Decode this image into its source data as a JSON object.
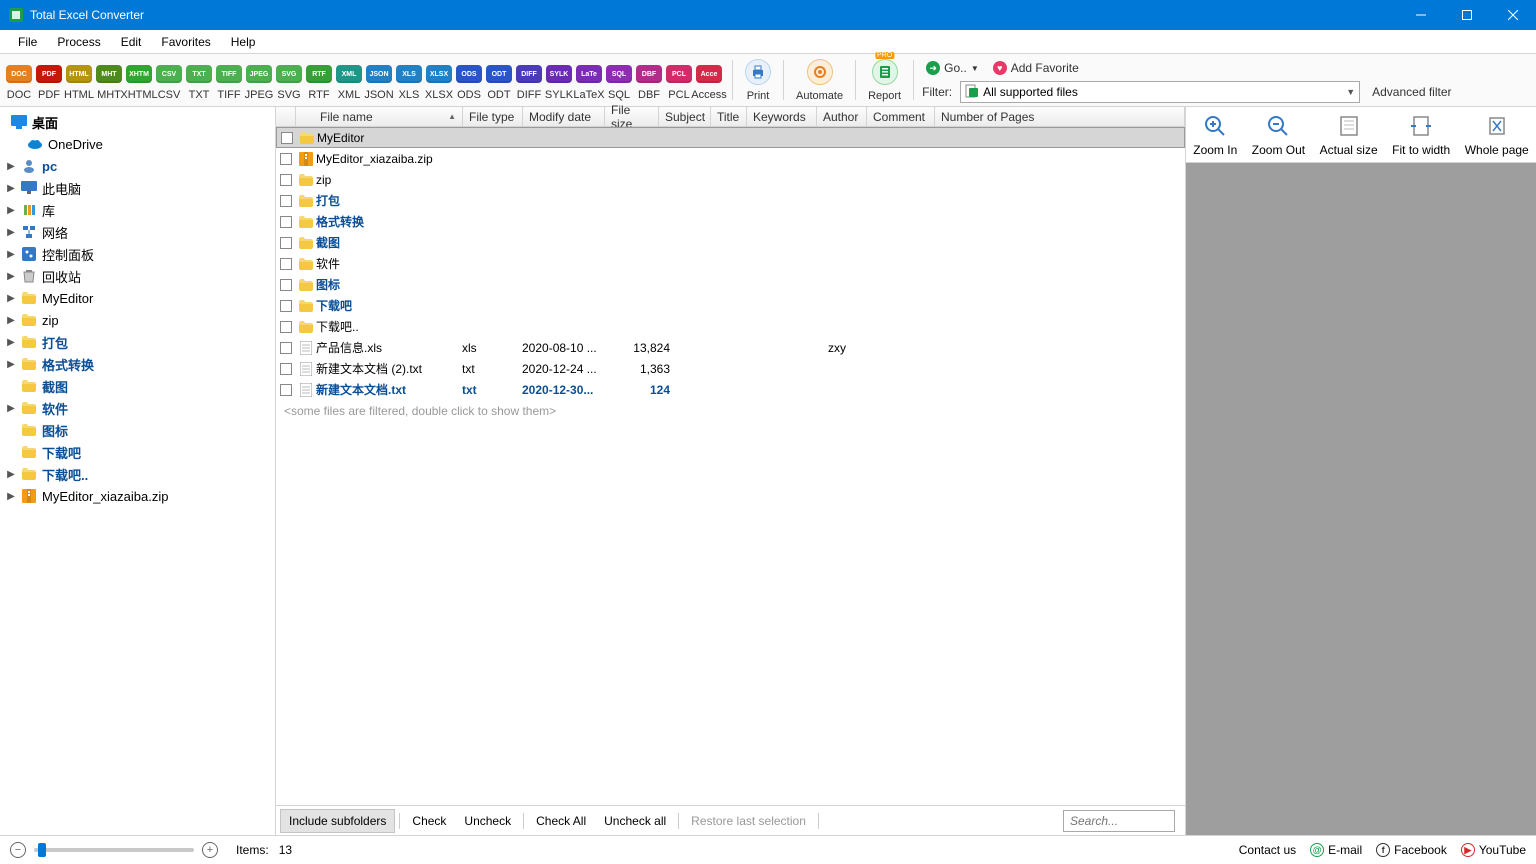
{
  "app": {
    "title": "Total Excel Converter"
  },
  "menu": [
    "File",
    "Process",
    "Edit",
    "Favorites",
    "Help"
  ],
  "formats": [
    {
      "label": "DOC",
      "color": "#e67e22"
    },
    {
      "label": "PDF",
      "color": "#c61808"
    },
    {
      "label": "HTML",
      "color": "#b59410"
    },
    {
      "label": "MHT",
      "color": "#4e8b1c"
    },
    {
      "label": "XHTML",
      "color": "#2fa62f"
    },
    {
      "label": "CSV",
      "color": "#4caf50"
    },
    {
      "label": "TXT",
      "color": "#4caf50"
    },
    {
      "label": "TIFF",
      "color": "#4caf50"
    },
    {
      "label": "JPEG",
      "color": "#4caf50"
    },
    {
      "label": "SVG",
      "color": "#4caf50"
    },
    {
      "label": "RTF",
      "color": "#36a036"
    },
    {
      "label": "XML",
      "color": "#1f9688"
    },
    {
      "label": "JSON",
      "color": "#2280c4"
    },
    {
      "label": "XLS",
      "color": "#2280c4"
    },
    {
      "label": "XLSX",
      "color": "#2280c4"
    },
    {
      "label": "ODS",
      "color": "#2a55c6"
    },
    {
      "label": "ODT",
      "color": "#2a55c6"
    },
    {
      "label": "DIFF",
      "color": "#4b3bb8"
    },
    {
      "label": "SYLK",
      "color": "#6a2cb4"
    },
    {
      "label": "LaTeX",
      "color": "#7a2cb4"
    },
    {
      "label": "SQL",
      "color": "#8e2cb4"
    },
    {
      "label": "DBF",
      "color": "#b42c8a"
    },
    {
      "label": "PCL",
      "color": "#d12c6a"
    },
    {
      "label": "Access",
      "color": "#d12c4a"
    }
  ],
  "tools": {
    "print": "Print",
    "automate": "Automate",
    "report": "Report",
    "go": "Go.. ",
    "addfav": "Add Favorite",
    "filter_label": "Filter:",
    "filter_value": "All supported files",
    "advfilter": "Advanced filter"
  },
  "tree": {
    "root": "桌面",
    "items": [
      {
        "label": "OneDrive",
        "icon": "cloud",
        "expandable": false,
        "child": true
      },
      {
        "label": "pc",
        "icon": "user",
        "expandable": true,
        "blue": true
      },
      {
        "label": "此电脑",
        "icon": "monitor",
        "expandable": true
      },
      {
        "label": "库",
        "icon": "library",
        "expandable": true
      },
      {
        "label": "网络",
        "icon": "network",
        "expandable": true
      },
      {
        "label": "控制面板",
        "icon": "control",
        "expandable": true
      },
      {
        "label": "回收站",
        "icon": "trash",
        "expandable": true
      },
      {
        "label": "MyEditor",
        "icon": "folder",
        "expandable": true
      },
      {
        "label": "zip",
        "icon": "folder",
        "expandable": true
      },
      {
        "label": "打包",
        "icon": "folder",
        "expandable": true,
        "blue": true
      },
      {
        "label": "格式转换",
        "icon": "folder",
        "expandable": true,
        "blue": true
      },
      {
        "label": "截图",
        "icon": "folder",
        "expandable": false,
        "blue": true
      },
      {
        "label": "软件",
        "icon": "folder",
        "expandable": true,
        "blue": true
      },
      {
        "label": "图标",
        "icon": "folder",
        "expandable": false,
        "blue": true
      },
      {
        "label": "下载吧",
        "icon": "folder",
        "expandable": false,
        "blue": true
      },
      {
        "label": "下载吧..",
        "icon": "folder",
        "expandable": true,
        "blue": true
      },
      {
        "label": "MyEditor_xiazaiba.zip",
        "icon": "zip",
        "expandable": true
      }
    ]
  },
  "file_header": [
    "File name",
    "File type",
    "Modify date",
    "File size",
    "Subject",
    "Title",
    "Keywords",
    "Author",
    "Comment",
    "Number of Pages"
  ],
  "files": [
    {
      "name": "MyEditor",
      "type": "",
      "date": "",
      "size": "",
      "author": "",
      "icon": "folder",
      "selected": true
    },
    {
      "name": "MyEditor_xiazaiba.zip",
      "type": "",
      "date": "",
      "size": "",
      "author": "",
      "icon": "zip"
    },
    {
      "name": "zip",
      "type": "",
      "date": "",
      "size": "",
      "author": "",
      "icon": "folder"
    },
    {
      "name": "打包",
      "type": "",
      "date": "",
      "size": "",
      "author": "",
      "icon": "folder",
      "blue": true
    },
    {
      "name": "格式转换",
      "type": "",
      "date": "",
      "size": "",
      "author": "",
      "icon": "folder",
      "blue": true
    },
    {
      "name": "截图",
      "type": "",
      "date": "",
      "size": "",
      "author": "",
      "icon": "folder",
      "blue": true
    },
    {
      "name": "软件",
      "type": "",
      "date": "",
      "size": "",
      "author": "",
      "icon": "folder"
    },
    {
      "name": "图标",
      "type": "",
      "date": "",
      "size": "",
      "author": "",
      "icon": "folder",
      "blue": true
    },
    {
      "name": "下载吧",
      "type": "",
      "date": "",
      "size": "",
      "author": "",
      "icon": "folder",
      "blue": true
    },
    {
      "name": "下载吧..",
      "type": "",
      "date": "",
      "size": "",
      "author": "",
      "icon": "folder"
    },
    {
      "name": "产品信息.xls",
      "type": "xls",
      "date": "2020-08-10 ...",
      "size": "13,824",
      "author": "zxy",
      "icon": "file"
    },
    {
      "name": "新建文本文档 (2).txt",
      "type": "txt",
      "date": "2020-12-24 ...",
      "size": "1,363",
      "author": "",
      "icon": "file"
    },
    {
      "name": "新建文本文档.txt",
      "type": "txt",
      "date": "2020-12-30...",
      "size": "124",
      "author": "",
      "icon": "file",
      "blue": true
    }
  ],
  "filtered_note": "<some files are filtered, double click to show them>",
  "bottom_buttons": {
    "include": "Include subfolders",
    "check": "Check",
    "uncheck": "Uncheck",
    "checkall": "Check All",
    "uncheckall": "Uncheck all",
    "restore": "Restore last selection",
    "search_placeholder": "Search..."
  },
  "preview_tools": [
    "Zoom In",
    "Zoom Out",
    "Actual size",
    "Fit to width",
    "Whole page"
  ],
  "status": {
    "items_label": "Items:",
    "items_count": "13",
    "contact": "Contact us",
    "email": "E-mail",
    "facebook": "Facebook",
    "youtube": "YouTube"
  }
}
